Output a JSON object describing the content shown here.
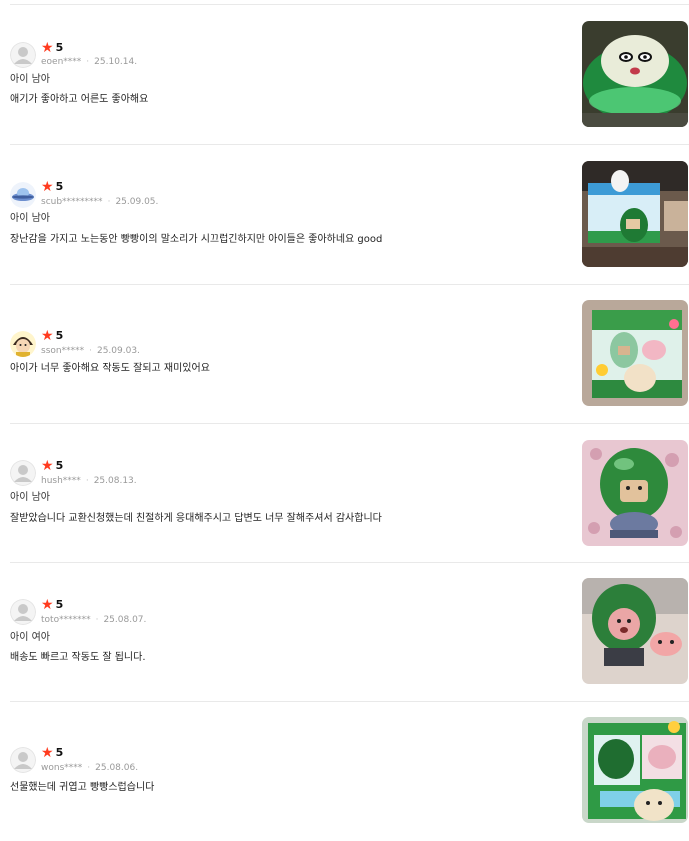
{
  "reviews": [
    {
      "score": "5",
      "user": "eoen****",
      "date": "25.10.14.",
      "option": "아이 남아",
      "text": "애기가 좋아하고 어른도 좋아해요",
      "avatar": "default-avatar",
      "photo": "toy-closeup-green-lid"
    },
    {
      "score": "5",
      "user": "scub*********",
      "date": "25.09.05.",
      "option": "아이 남아",
      "text": "장난감을 가지고 노는동안 빵빵이의 말소리가 시끄럽긴하지만 아이들은 좋아하네요 good",
      "avatar": "ufo-avatar",
      "photo": "toy-box-on-table"
    },
    {
      "score": "5",
      "user": "sson*****",
      "date": "25.09.03.",
      "option": "",
      "text": "아이가 너무 좋아해요 작동도 잘되고 재미있어요",
      "avatar": "cartoon-girl-avatar",
      "photo": "toy-package-front"
    },
    {
      "score": "5",
      "user": "hush****",
      "date": "25.08.13.",
      "option": "아이 남아",
      "text": "잘받았습니다 교환신청했는데 친절하게 응대해주시고 답변도 너무 잘해주셔서 감사합니다",
      "avatar": "default-avatar",
      "photo": "toy-on-pink-blanket"
    },
    {
      "score": "5",
      "user": "toto*******",
      "date": "25.08.07.",
      "option": "아이 여아",
      "text": "배송도 빠르고 작동도 잘 됩니다.",
      "avatar": "default-avatar",
      "photo": "toy-with-pink-figure"
    },
    {
      "score": "5",
      "user": "wons****",
      "date": "25.08.06.",
      "option": "",
      "text": "선물했는데 귀엽고 빵빵스럽습니다",
      "avatar": "default-avatar",
      "photo": "toy-package-held"
    }
  ],
  "colors": {
    "star": "#ff3b1f",
    "meta": "#999999",
    "divider": "#e9e9e9"
  }
}
